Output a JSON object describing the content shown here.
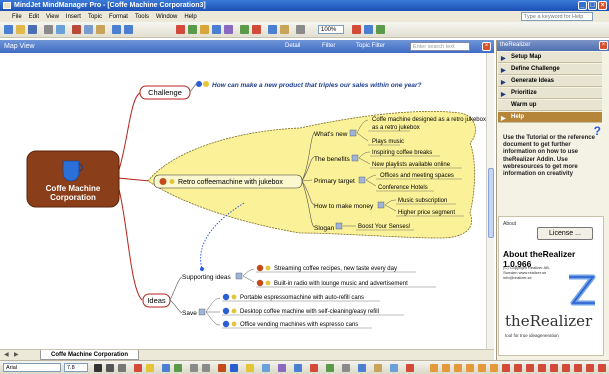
{
  "window": {
    "title": "MindJet MindManager Pro - [Coffe Machine Corporation3]"
  },
  "menu": [
    "File",
    "Edit",
    "View",
    "Insert",
    "Topic",
    "Format",
    "Tools",
    "Window",
    "Help"
  ],
  "ask_placeholder": "Type a keyword for Help",
  "map_view": {
    "title": "Map View",
    "detail": "Detail",
    "filter": "Filter",
    "topic_filter": "Topic Filter",
    "search_placeholder": "Enter search text"
  },
  "zoom": "100%",
  "central": {
    "line1": "Coffe Machine",
    "line2": "Corporation"
  },
  "challenge": {
    "label": "Challenge",
    "question": "How can make a new product that triples our sales within one year?"
  },
  "retro": {
    "label": "Retro coffeemachine with jukebox",
    "groups": [
      {
        "label": "What's new",
        "items": [
          "Coffe machine designed as a retro jukebox",
          "Plays music"
        ]
      },
      {
        "label": "The benefits",
        "items": [
          "Inspiring coffee breaks",
          "New playlists available online"
        ]
      },
      {
        "label": "Primary target",
        "items": [
          "Offices and meeting spaces",
          "Conference Hotels"
        ]
      },
      {
        "label": "How to make money",
        "items": [
          "Music subscription",
          "Higher price segment"
        ]
      },
      {
        "label": "Slogan",
        "items": [
          "Boost Your Senses!"
        ]
      }
    ]
  },
  "ideas": {
    "label": "Ideas",
    "supporting": {
      "label": "Supporting ideas",
      "items": [
        "Streaming coffee recipes, new taste every day",
        "Built-in radio with lounge music and advertisement"
      ]
    },
    "save": {
      "label": "Save",
      "items": [
        "Portable espressomachine with auto-refill cans",
        "Desktop coffee machine with self-cleaning/easy refill",
        "Office vending machines with espresso cans"
      ]
    }
  },
  "tab": "Coffe Machine Corporation",
  "font": {
    "name": "Arial",
    "size": "7.8"
  },
  "sidebar": {
    "title": "theRealizer",
    "nav": [
      "Setup Map",
      "Define Challenge",
      "Generate Ideas",
      "Prioritize",
      "Warm up",
      "Help"
    ],
    "active": "Help",
    "help_text": "Use the Tutorial or the reference document to get further information on how to use theRealizer Addin. Use webresources to get more information on creativity",
    "about_label": "About",
    "license": "License ...",
    "about_title": "About theRealizer 1.0.966",
    "copyright": "(C) Copyright Realizer AB, Sweden www.realizer.se info@realizer.se",
    "logo": "theRealizer",
    "tagline": "tool for true ideageneration"
  },
  "colors": {
    "central": "#8b3e1a",
    "callout": "#fbf199",
    "branch": "#b5221c",
    "accent": "#2b5ed1"
  }
}
